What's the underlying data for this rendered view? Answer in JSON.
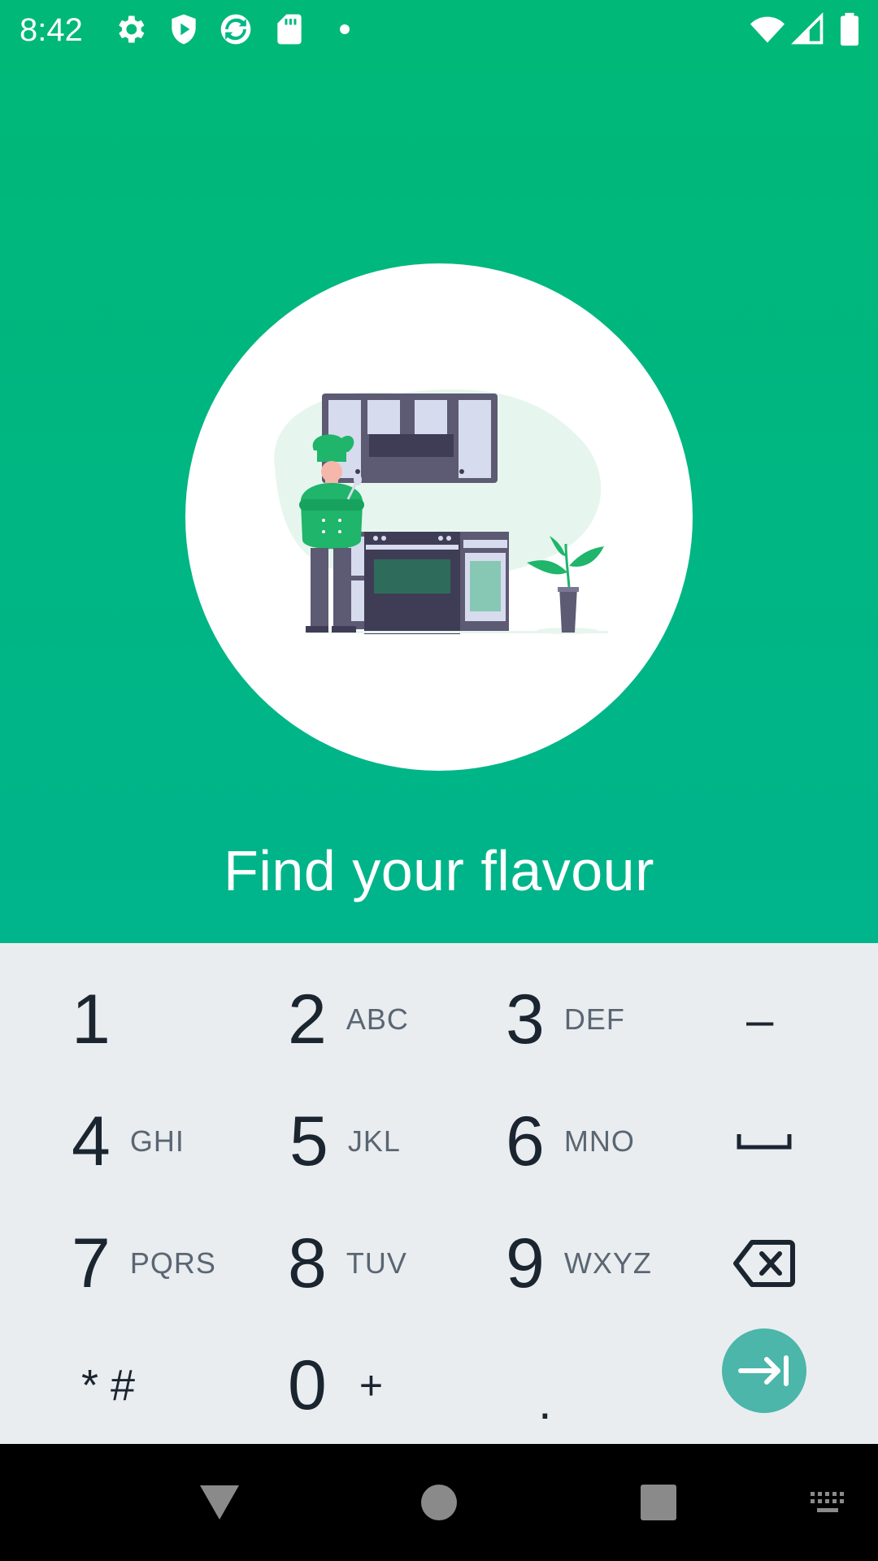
{
  "status_bar": {
    "time": "8:42",
    "icons_left": [
      "gear-icon",
      "play-protect-icon",
      "sync-icon",
      "sd-card-icon",
      "notification-dot"
    ],
    "icons_right": [
      "wifi-icon",
      "signal-icon",
      "battery-icon"
    ]
  },
  "onboarding": {
    "title": "Find your flavour",
    "illustration": "chef-kitchen-illustration"
  },
  "colors": {
    "accent": "#00b884",
    "keyboard_bg": "#e9edf0",
    "enter_button": "#4bb6a9",
    "chef_green": "#1fb56a"
  },
  "keyboard": {
    "rows": [
      [
        {
          "num": "1",
          "letters": ""
        },
        {
          "num": "2",
          "letters": "ABC"
        },
        {
          "num": "3",
          "letters": "DEF"
        },
        {
          "symbol": "–"
        }
      ],
      [
        {
          "num": "4",
          "letters": "GHI"
        },
        {
          "num": "5",
          "letters": "JKL"
        },
        {
          "num": "6",
          "letters": "MNO"
        },
        {
          "symbol": "space-icon"
        }
      ],
      [
        {
          "num": "7",
          "letters": "PQRS"
        },
        {
          "num": "8",
          "letters": "TUV"
        },
        {
          "num": "9",
          "letters": "WXYZ"
        },
        {
          "symbol": "backspace-icon"
        }
      ],
      [
        {
          "symbol": "* #"
        },
        {
          "num": "0",
          "letters": "+"
        },
        {
          "symbol": "."
        },
        {
          "symbol": "tab-next-icon"
        }
      ]
    ],
    "k1": "1",
    "k2": "2",
    "k2l": "ABC",
    "k3": "3",
    "k3l": "DEF",
    "dash": "–",
    "k4": "4",
    "k4l": "GHI",
    "k5": "5",
    "k5l": "JKL",
    "k6": "6",
    "k6l": "MNO",
    "k7": "7",
    "k7l": "PQRS",
    "k8": "8",
    "k8l": "TUV",
    "k9": "9",
    "k9l": "WXYZ",
    "star_hash": "* #",
    "k0": "0",
    "plus": "+",
    "dot": "."
  },
  "nav_bar": {
    "items": [
      "back-icon",
      "home-icon",
      "recents-icon",
      "keyboard-switch-icon"
    ]
  }
}
